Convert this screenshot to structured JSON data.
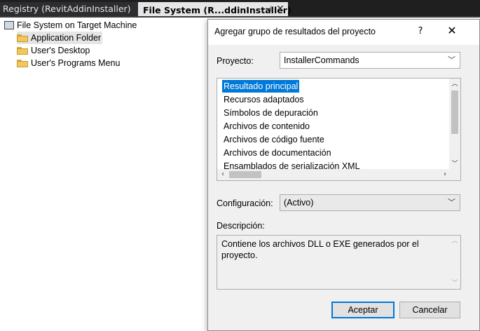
{
  "tabs": {
    "inactive_label": "Registry (RevitAddinInstaller)",
    "active_label": "File System (R...ddinInstaller)",
    "pin_glyph": "⊣",
    "close_glyph": "✕"
  },
  "tree": {
    "root_label": "File System on Target Machine",
    "items": [
      {
        "label": "Application Folder"
      },
      {
        "label": "User's Desktop"
      },
      {
        "label": "User's Programs Menu"
      }
    ]
  },
  "dialog": {
    "title": "Agregar grupo de resultados del proyecto",
    "help_glyph": "?",
    "close_glyph": "✕",
    "project_label": "Proyecto:",
    "project_value": "InstallerCommands",
    "outputs": [
      "Resultado principal",
      "Recursos adaptados",
      "Símbolos de depuración",
      "Archivos de contenido",
      "Archivos de código fuente",
      "Archivos de documentación",
      "Ensamblados de serialización XML"
    ],
    "selected_output": "Resultado principal",
    "configuration_label": "Configuración:",
    "configuration_value": "(Activo)",
    "description_label": "Descripción:",
    "description_text": "Contiene los archivos DLL o EXE generados por el proyecto.",
    "ok_label": "Aceptar",
    "cancel_label": "Cancelar"
  },
  "colors": {
    "selection": "#0078d7",
    "tab_strip": "#1f1f1f",
    "dialog_bg": "#f0f0f0"
  }
}
